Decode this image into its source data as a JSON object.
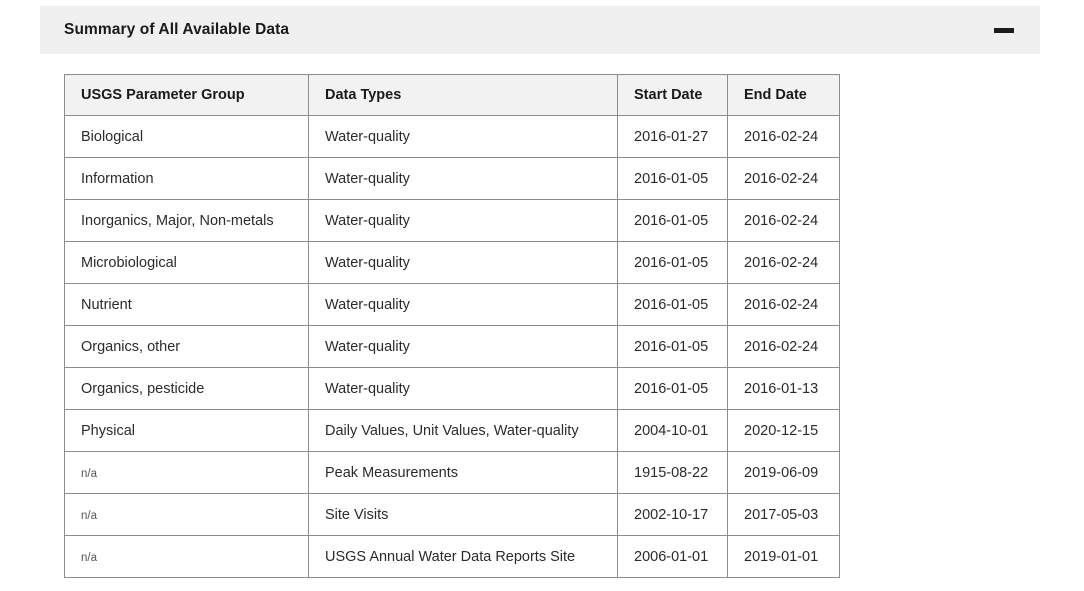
{
  "panel": {
    "title": "Summary of All Available Data",
    "collapse_icon": "minus-icon",
    "collapse_label": "Collapse section"
  },
  "table": {
    "columns": [
      "USGS Parameter Group",
      "Data Types",
      "Start Date",
      "End Date"
    ],
    "na_label": "n/a",
    "rows": [
      {
        "parameter_group": "Biological",
        "data_types": "Water-quality",
        "start_date": "2016-01-27",
        "end_date": "2016-02-24",
        "na": false
      },
      {
        "parameter_group": "Information",
        "data_types": "Water-quality",
        "start_date": "2016-01-05",
        "end_date": "2016-02-24",
        "na": false
      },
      {
        "parameter_group": "Inorganics, Major, Non-metals",
        "data_types": "Water-quality",
        "start_date": "2016-01-05",
        "end_date": "2016-02-24",
        "na": false
      },
      {
        "parameter_group": "Microbiological",
        "data_types": "Water-quality",
        "start_date": "2016-01-05",
        "end_date": "2016-02-24",
        "na": false
      },
      {
        "parameter_group": "Nutrient",
        "data_types": "Water-quality",
        "start_date": "2016-01-05",
        "end_date": "2016-02-24",
        "na": false
      },
      {
        "parameter_group": "Organics, other",
        "data_types": "Water-quality",
        "start_date": "2016-01-05",
        "end_date": "2016-02-24",
        "na": false
      },
      {
        "parameter_group": "Organics, pesticide",
        "data_types": "Water-quality",
        "start_date": "2016-01-05",
        "end_date": "2016-01-13",
        "na": false
      },
      {
        "parameter_group": "Physical",
        "data_types": "Daily Values, Unit Values, Water-quality",
        "start_date": "2004-10-01",
        "end_date": "2020-12-15",
        "na": false
      },
      {
        "parameter_group": "n/a",
        "data_types": "Peak Measurements",
        "start_date": "1915-08-22",
        "end_date": "2019-06-09",
        "na": true
      },
      {
        "parameter_group": "n/a",
        "data_types": "Site Visits",
        "start_date": "2002-10-17",
        "end_date": "2017-05-03",
        "na": true
      },
      {
        "parameter_group": "n/a",
        "data_types": "USGS Annual Water Data Reports Site",
        "start_date": "2006-01-01",
        "end_date": "2019-01-01",
        "na": true
      }
    ]
  },
  "colors": {
    "panel_header_bg": "#f0f0f0",
    "table_header_bg": "#f2f2f2",
    "border": "#8c8c8c",
    "text": "#2b2b2b",
    "muted_text": "#555555"
  }
}
